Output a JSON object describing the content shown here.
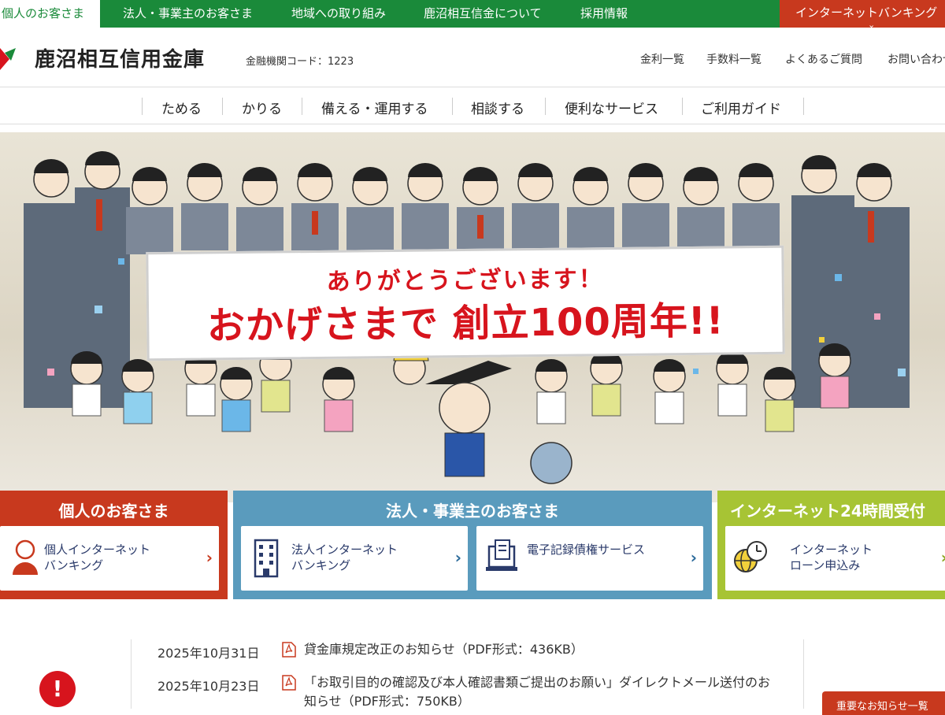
{
  "topbar": {
    "tabs": [
      "個人のお客さま",
      "法人・事業主のお客さま",
      "地域への取り組み",
      "鹿沼相互信金について",
      "採用情報"
    ],
    "internet_banking": "インターネットバンキング"
  },
  "header": {
    "logo_text": "鹿沼相互信用金庫",
    "bank_code": "金融機関コード：1223",
    "links": [
      "金利一覧",
      "手数料一覧",
      "よくあるご質問",
      "お問い合わせ"
    ]
  },
  "nav": {
    "items": [
      "ためる",
      "かりる",
      "備える・運用する",
      "相談する",
      "便利なサービス",
      "ご利用ガイド"
    ]
  },
  "hero": {
    "line1": "ありがとうございます！",
    "line2": "おかげさまで 創立100周年!!"
  },
  "cards": {
    "personal": {
      "title": "個人のお客さま",
      "item": "個人インターネット\nバンキング",
      "color": "#c8391e"
    },
    "business": {
      "title": "法人・事業主のお客さま",
      "items": [
        "法人インターネット\nバンキング",
        "電子記録債権サービス"
      ],
      "color": "#5a9bbd"
    },
    "internet": {
      "title": "インターネット24時間受付",
      "item": "インターネット\nローン申込み",
      "color": "#a7c434"
    }
  },
  "news": {
    "items": [
      {
        "date": "2025年10月31日",
        "text": "貸金庫規定改正のお知らせ（PDF形式：436KB）"
      },
      {
        "date": "2025年10月23日",
        "text": "「お取引目的の確認及び本人確認書類ご提出のお願い」ダイレクトメール送付のお知らせ（PDF形式：750KB）"
      }
    ],
    "important_button": "重要なお知らせ一覧"
  }
}
